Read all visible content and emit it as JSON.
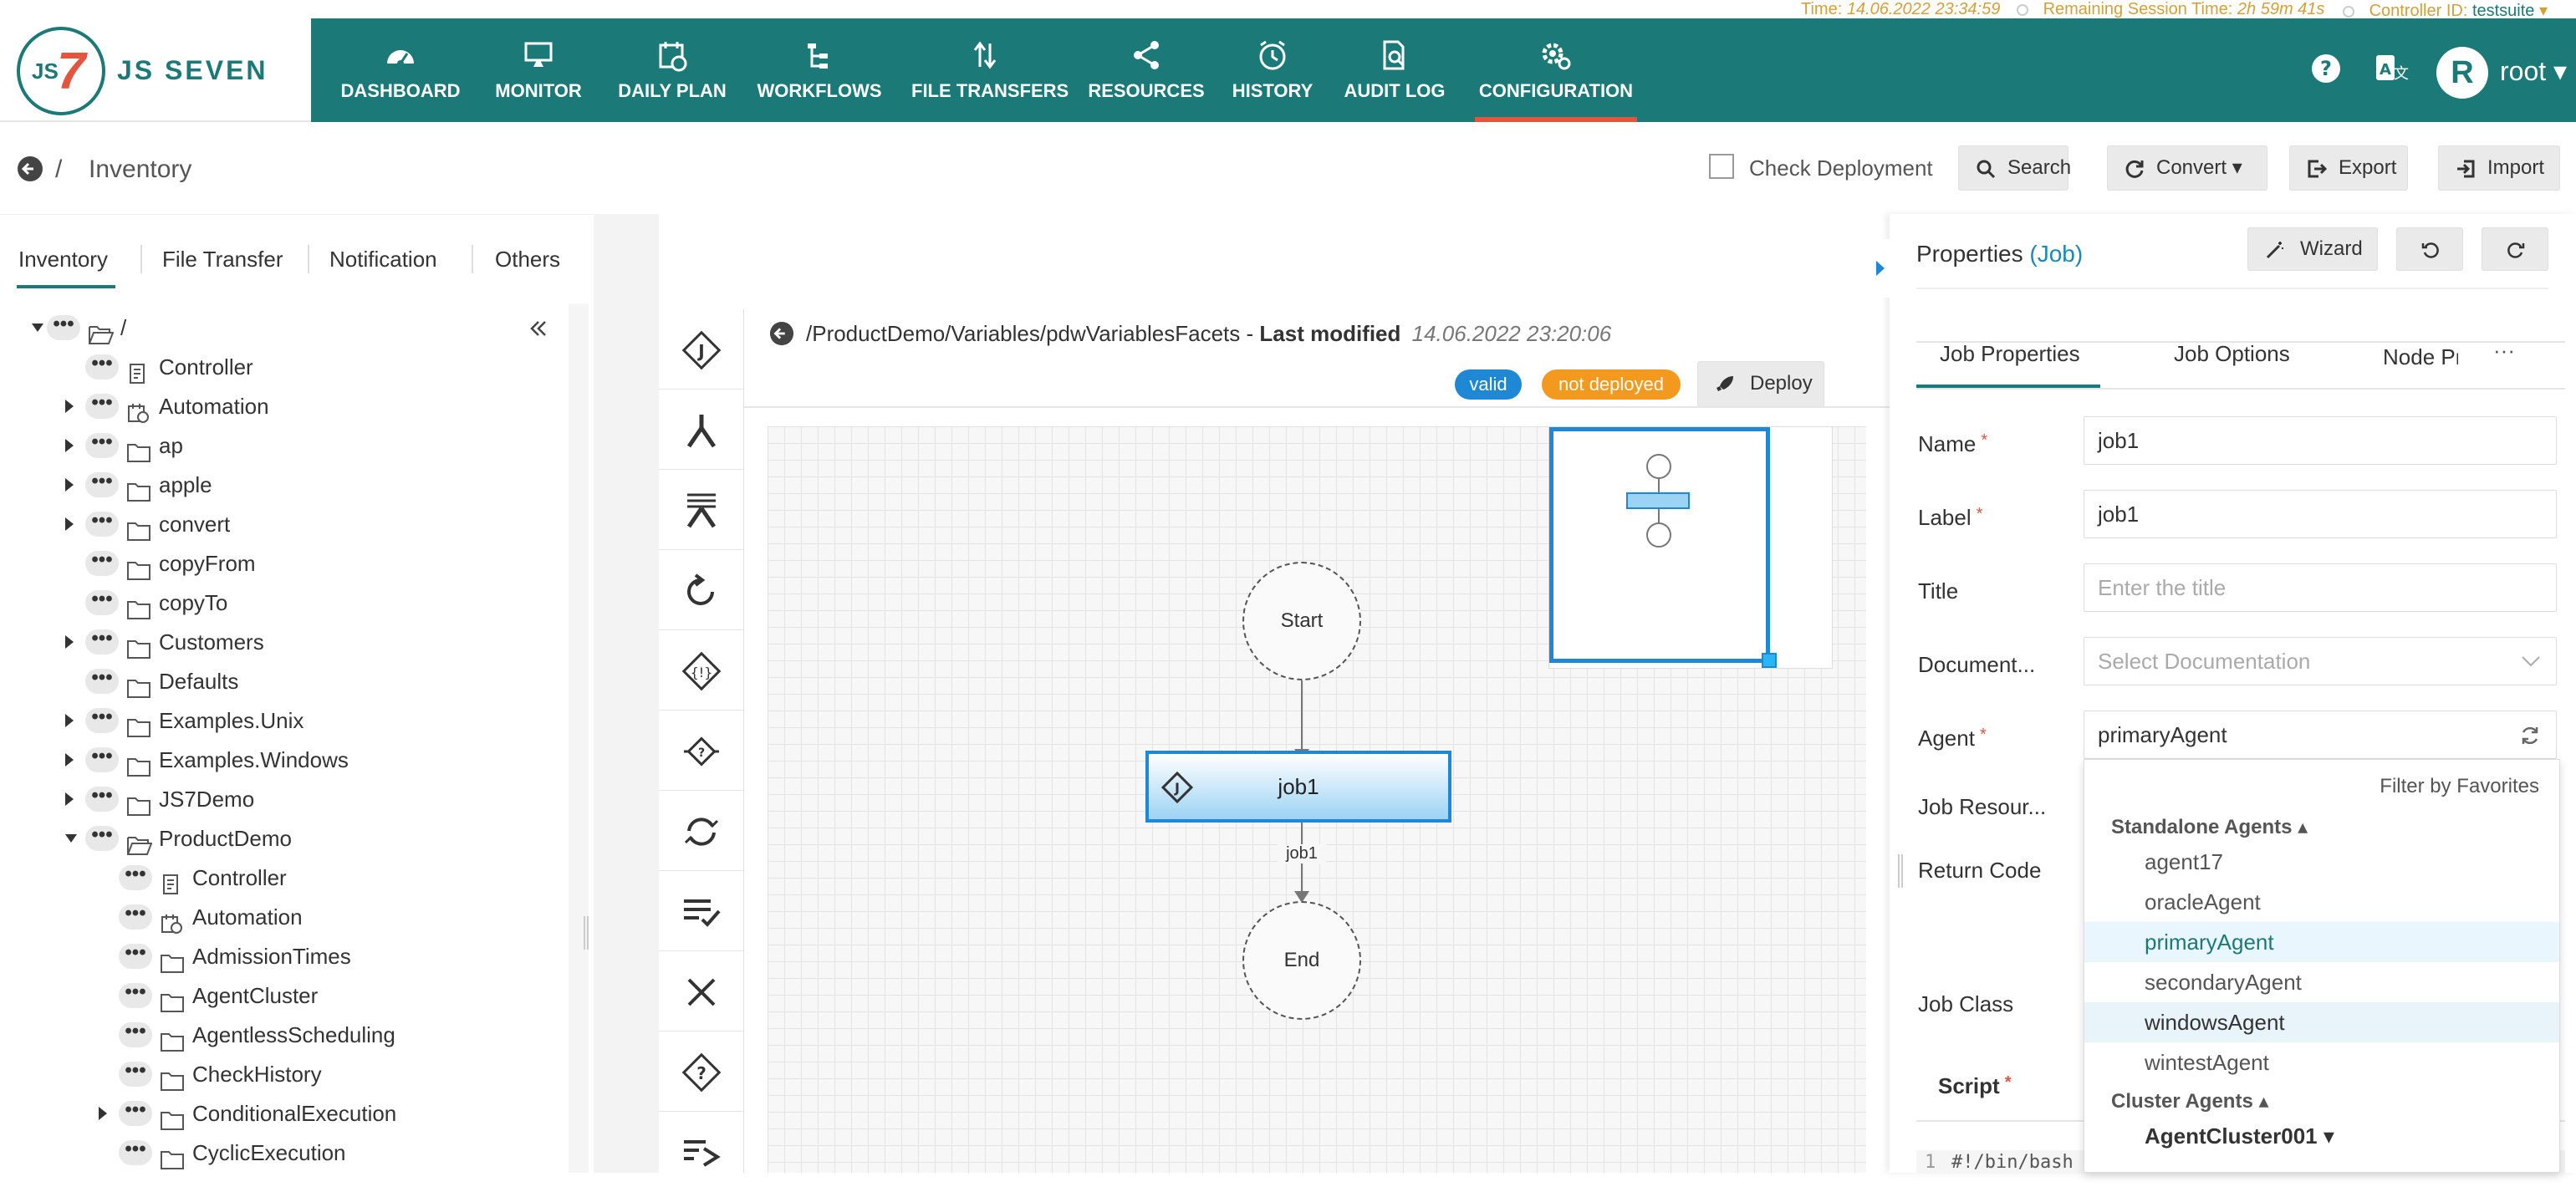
{
  "status": {
    "time_label": "Time:",
    "time_value": "14.06.2022 23:34:59",
    "session_label": "Remaining Session Time:",
    "session_value": "2h 59m 41s",
    "controller_label": "Controller ID:",
    "controller_value": "testsuite"
  },
  "brand": {
    "logo_text": "JS SEVEN",
    "logo_js": "JS",
    "logo_num": "7"
  },
  "nav": [
    {
      "label": "DASHBOARD",
      "icon": "dashboard-icon"
    },
    {
      "label": "MONITOR",
      "icon": "monitor-icon"
    },
    {
      "label": "DAILY PLAN",
      "icon": "calendar-icon"
    },
    {
      "label": "WORKFLOWS",
      "icon": "workflow-icon"
    },
    {
      "label": "FILE TRANSFERS",
      "icon": "transfer-icon"
    },
    {
      "label": "RESOURCES",
      "icon": "share-icon"
    },
    {
      "label": "HISTORY",
      "icon": "clock-icon"
    },
    {
      "label": "AUDIT LOG",
      "icon": "audit-icon"
    },
    {
      "label": "CONFIGURATION",
      "icon": "gear-icon",
      "active": true
    }
  ],
  "user": {
    "avatar": "R",
    "name": "root"
  },
  "breadcrumb": {
    "sep": "/",
    "title": "Inventory"
  },
  "actions": {
    "check_deployment": "Check Deployment",
    "search": "Search",
    "convert": "Convert",
    "export": "Export",
    "import": "Import"
  },
  "left_tabs": [
    "Inventory",
    "File Transfer",
    "Notification",
    "Others"
  ],
  "tree": [
    {
      "label": "/",
      "icon": "folder-open-icon",
      "caret": "down",
      "level": 0
    },
    {
      "label": "Controller",
      "icon": "controller-icon",
      "caret": "",
      "level": 1
    },
    {
      "label": "Automation",
      "icon": "calendar-icon",
      "caret": "right",
      "level": 1
    },
    {
      "label": "ap",
      "icon": "folder-icon",
      "caret": "right",
      "level": 1
    },
    {
      "label": "apple",
      "icon": "folder-icon",
      "caret": "right",
      "level": 1
    },
    {
      "label": "convert",
      "icon": "folder-icon",
      "caret": "right",
      "level": 1
    },
    {
      "label": "copyFrom",
      "icon": "folder-icon",
      "caret": "",
      "level": 1
    },
    {
      "label": "copyTo",
      "icon": "folder-icon",
      "caret": "",
      "level": 1
    },
    {
      "label": "Customers",
      "icon": "folder-icon",
      "caret": "right",
      "level": 1
    },
    {
      "label": "Defaults",
      "icon": "folder-icon",
      "caret": "",
      "level": 1
    },
    {
      "label": "Examples.Unix",
      "icon": "folder-icon",
      "caret": "right",
      "level": 1
    },
    {
      "label": "Examples.Windows",
      "icon": "folder-icon",
      "caret": "right",
      "level": 1
    },
    {
      "label": "JS7Demo",
      "icon": "folder-icon",
      "caret": "right",
      "level": 1
    },
    {
      "label": "ProductDemo",
      "icon": "folder-open-icon",
      "caret": "down",
      "level": 1
    },
    {
      "label": "Controller",
      "icon": "controller-icon",
      "caret": "",
      "level": 2
    },
    {
      "label": "Automation",
      "icon": "calendar-icon",
      "caret": "",
      "level": 2
    },
    {
      "label": "AdmissionTimes",
      "icon": "folder-icon",
      "caret": "",
      "level": 2
    },
    {
      "label": "AgentCluster",
      "icon": "folder-icon",
      "caret": "",
      "level": 2
    },
    {
      "label": "AgentlessScheduling",
      "icon": "folder-icon",
      "caret": "",
      "level": 2
    },
    {
      "label": "CheckHistory",
      "icon": "folder-icon",
      "caret": "",
      "level": 2
    },
    {
      "label": "ConditionalExecution",
      "icon": "folder-icon",
      "caret": "right",
      "level": 2
    },
    {
      "label": "CyclicExecution",
      "icon": "folder-icon",
      "caret": "",
      "level": 2
    }
  ],
  "editor": {
    "path": "/ProductDemo/Variables/pdwVariablesFacets",
    "sep": " - ",
    "modified_label": "Last modified",
    "modified_value": "14.06.2022 23:20:06",
    "badge_valid": "valid",
    "badge_deployed": "not deployed",
    "deploy": "Deploy",
    "node_start": "Start",
    "node_job": "job1",
    "edge_label": "job1",
    "node_end": "End"
  },
  "properties": {
    "title": "Properties",
    "type": "(Job)",
    "wizard": "Wizard",
    "tabs": [
      "Job Properties",
      "Job Options",
      "Node Pr"
    ],
    "more": "···",
    "name_label": "Name",
    "name_value": "job1",
    "label_label": "Label",
    "label_value": "job1",
    "title_label": "Title",
    "title_placeholder": "Enter the title",
    "doc_label": "Document...",
    "doc_placeholder": "Select Documentation",
    "agent_label": "Agent",
    "agent_value": "primaryAgent",
    "jobres_label": "Job Resour...",
    "return_label": "Return Code",
    "jobclass_label": "Job Class",
    "script_label": "Script",
    "script_line_no": "1",
    "script_first": "#!/bin/bash"
  },
  "agent_dropdown": {
    "filter": "Filter by Favorites",
    "standalone_label": "Standalone Agents",
    "standalone": [
      "agent17",
      "oracleAgent",
      "primaryAgent",
      "secondaryAgent",
      "windowsAgent",
      "wintestAgent"
    ],
    "selected": "primaryAgent",
    "hovered": "windowsAgent",
    "cluster_label": "Cluster Agents",
    "cluster": [
      "AgentCluster001"
    ]
  },
  "colors": {
    "primary": "#1b7a78",
    "accent": "#e4553e",
    "valid": "#1e88d4",
    "not_deployed": "#f39a1e",
    "node": "#1e88d4"
  }
}
